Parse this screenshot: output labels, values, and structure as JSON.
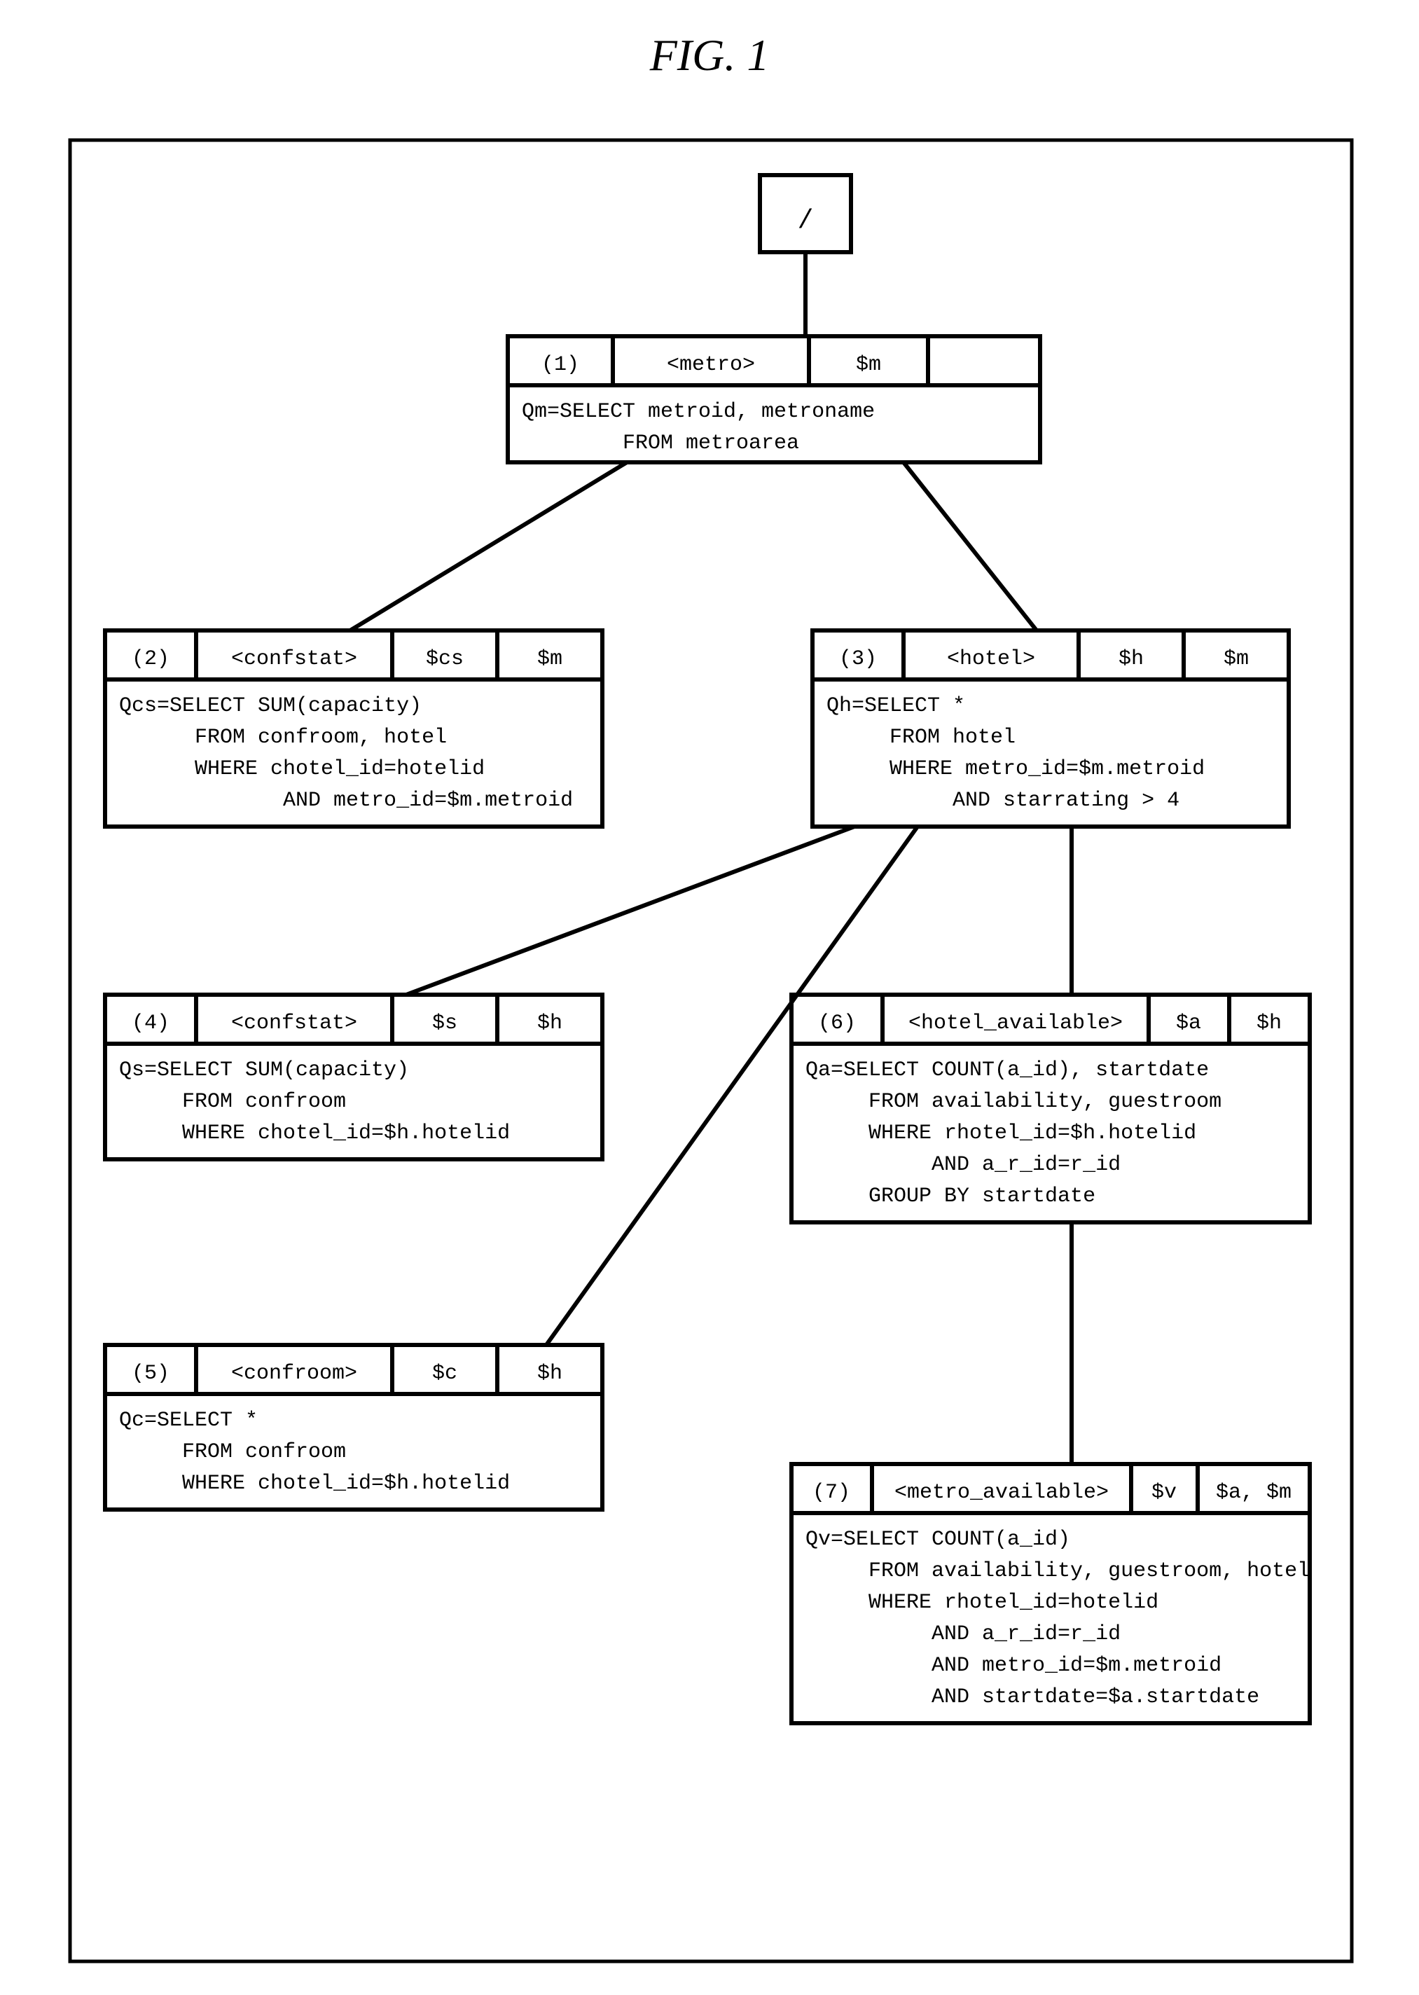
{
  "figure_label": "FIG.  1",
  "root": {
    "label": "/"
  },
  "nodes": {
    "n1": {
      "num": "(1)",
      "tag": "<metro>",
      "var": "$m",
      "parent": "",
      "body": "Qm=SELECT metroid, metroname\n        FROM metroarea"
    },
    "n2": {
      "num": "(2)",
      "tag": "<confstat>",
      "var": "$cs",
      "parent": "$m",
      "body": "Qcs=SELECT SUM(capacity)\n      FROM confroom, hotel\n      WHERE chotel_id=hotelid\n             AND metro_id=$m.metroid"
    },
    "n3": {
      "num": "(3)",
      "tag": "<hotel>",
      "var": "$h",
      "parent": "$m",
      "body": "Qh=SELECT *\n     FROM hotel\n     WHERE metro_id=$m.metroid\n          AND starrating > 4"
    },
    "n4": {
      "num": "(4)",
      "tag": "<confstat>",
      "var": "$s",
      "parent": "$h",
      "body": "Qs=SELECT SUM(capacity)\n     FROM confroom\n     WHERE chotel_id=$h.hotelid"
    },
    "n5": {
      "num": "(5)",
      "tag": "<confroom>",
      "var": "$c",
      "parent": "$h",
      "body": "Qc=SELECT *\n     FROM confroom\n     WHERE chotel_id=$h.hotelid"
    },
    "n6": {
      "num": "(6)",
      "tag": "<hotel_available>",
      "var": "$a",
      "parent": "$h",
      "body": "Qa=SELECT COUNT(a_id), startdate\n     FROM availability, guestroom\n     WHERE rhotel_id=$h.hotelid\n          AND a_r_id=r_id\n     GROUP BY startdate"
    },
    "n7": {
      "num": "(7)",
      "tag": "<metro_available>",
      "var": "$v",
      "parent": "$a, $m",
      "body": "Qv=SELECT COUNT(a_id)\n     FROM availability, guestroom, hotel\n     WHERE rhotel_id=hotelid\n          AND a_r_id=r_id\n          AND metro_id=$m.metroid\n          AND startdate=$a.startdate"
    }
  }
}
